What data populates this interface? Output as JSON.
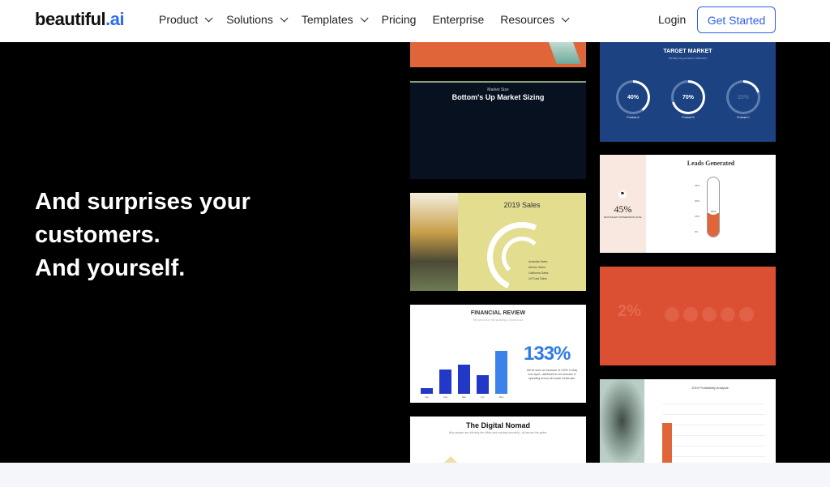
{
  "nav": {
    "logo": "beautiful",
    "logo_suffix": ".ai",
    "items": [
      {
        "label": "Product",
        "dropdown": true
      },
      {
        "label": "Solutions",
        "dropdown": true
      },
      {
        "label": "Templates",
        "dropdown": true
      },
      {
        "label": "Pricing",
        "dropdown": false
      },
      {
        "label": "Enterprise",
        "dropdown": false
      },
      {
        "label": "Resources",
        "dropdown": true
      }
    ],
    "login": "Login",
    "cta": "Get Started"
  },
  "hero": {
    "lines": [
      "And surprises your",
      "customers.",
      "And yourself."
    ]
  },
  "slides": {
    "market": {
      "kicker": "Market Size",
      "title": "Bottom's Up Market Sizing"
    },
    "sales": {
      "title": "2019 Sales",
      "legend": [
        "Australia Sales",
        "Mexico Sales",
        "California Sales",
        "US Total Sales"
      ]
    },
    "financial": {
      "title": "FINANCIAL REVIEW",
      "subtitle": "The proof is in the pudding. Check it out.",
      "big": "133%",
      "desc": "We've seen an increase of 133% in May over April—attributed to an increase in spending across all social media ads.",
      "months": [
        "Jan",
        "Feb",
        "Mar",
        "Apr",
        "May"
      ],
      "values": [
        10,
        45,
        55,
        35,
        80
      ]
    },
    "nomad": {
      "title": "The Digital Nomad",
      "subtitle": "Why people are ditching the office and working remotely—all across the globe."
    },
    "target": {
      "title": "TARGET MARKET",
      "subtitle": "Identify key prospect attributes",
      "rings": [
        {
          "value": "40%",
          "label": "Product A",
          "pct": 40
        },
        {
          "value": "70%",
          "label": "Product B",
          "pct": 70
        },
        {
          "value": "20%",
          "label": "Product C",
          "pct": 20
        }
      ]
    },
    "leads": {
      "title": "Leads Generated",
      "stat": "45%",
      "stat_label": "2020 SALES CONVERSION GOAL",
      "ticks": [
        "45%",
        "30%",
        "15%",
        "0%"
      ],
      "level": "15%"
    },
    "red": {
      "stat": "2%"
    },
    "profit": {
      "title": "2019 Profitability Analysis"
    }
  },
  "colors": {
    "accent": "#2f5ee8",
    "orange": "#e0663a",
    "navy": "#1b3f7a",
    "red": "#db4f33"
  }
}
